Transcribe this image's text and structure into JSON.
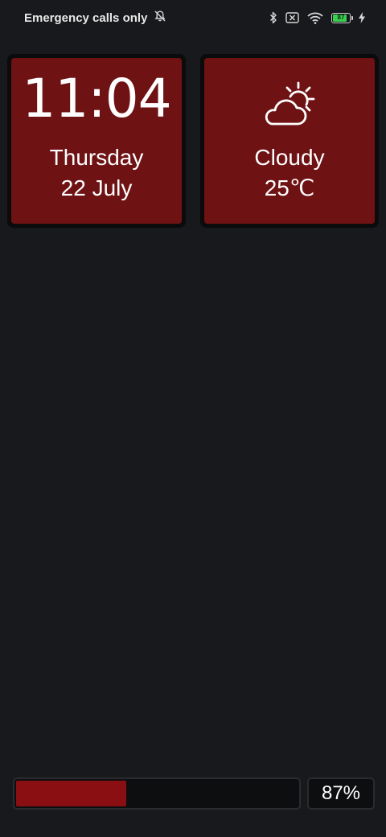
{
  "status_bar": {
    "carrier_text": "Emergency calls only",
    "notification_icon": "bell-off-icon",
    "icons": [
      "bluetooth-icon",
      "sim-off-icon",
      "wifi-icon",
      "battery-icon",
      "charging-icon"
    ],
    "battery_percent": "87",
    "battery_level": 0.87,
    "battery_color": "#3ad04f"
  },
  "clock_widget": {
    "time": "11:04",
    "day": "Thursday",
    "date": "22 July",
    "background_color": "#6f1213"
  },
  "weather_widget": {
    "icon": "partly-cloudy-icon",
    "condition": "Cloudy",
    "temperature": "25℃",
    "background_color": "#6f1213"
  },
  "battery_bar": {
    "level": 0.39,
    "label": "87%",
    "fill_color": "#8a0f12"
  }
}
